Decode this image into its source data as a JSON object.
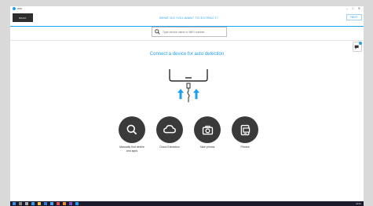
{
  "window": {
    "app_name": "WIN",
    "controls": [
      "–",
      "□",
      "✕"
    ]
  },
  "toolbar": {
    "back_label": "BACK",
    "headline": "WHAT DO YOU WANT TO EXTRACT?",
    "next_label": "NEXT"
  },
  "search": {
    "placeholder": "Type device name or IMEI number"
  },
  "main": {
    "connect_title": "Connect a device for auto detection",
    "actions": [
      {
        "icon": "magnifier-icon",
        "label": "Manually find device and apps"
      },
      {
        "icon": "cloud-icon",
        "label": "Cloud Extraction"
      },
      {
        "icon": "camera-icon",
        "label": "Take photos"
      },
      {
        "icon": "photo-import-icon",
        "label": "Photos"
      }
    ]
  },
  "colors": {
    "accent": "#1da1f2",
    "circle": "#3a3a3a",
    "taskbar": "#1b1b2b"
  },
  "taskbar": {
    "tray_text": "ENG"
  }
}
